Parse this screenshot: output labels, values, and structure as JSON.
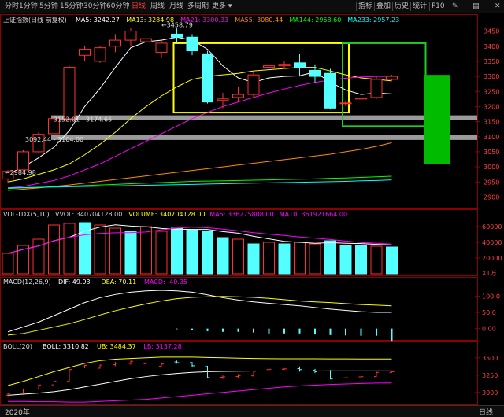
{
  "toolbar": {
    "tabs": [
      {
        "label": "分时",
        "key": "m1"
      },
      {
        "label": "1分钟",
        "key": "min1"
      },
      {
        "label": "5分钟",
        "key": "min5"
      },
      {
        "label": "15分钟",
        "key": "min15"
      },
      {
        "label": "30分钟",
        "key": "min30"
      },
      {
        "label": "60分钟",
        "key": "min60"
      },
      {
        "label": "日线",
        "key": "day"
      },
      {
        "label": "周线",
        "key": "week"
      },
      {
        "label": "月线",
        "key": "month"
      },
      {
        "label": "多周期",
        "key": "multi"
      },
      {
        "label": "更多",
        "key": "more"
      }
    ],
    "right_tabs": [
      "指标",
      "叠加",
      "历史",
      "统计",
      "F10"
    ],
    "right_icon_labels": [
      "画线",
      "选股"
    ]
  },
  "main_chart": {
    "title": "上证指数(日线 前复权)",
    "legend": [
      {
        "text": "MA5: 3242.27",
        "color": "#ffffff"
      },
      {
        "text": "MA13: 3284.98",
        "color": "#ffff00"
      },
      {
        "text": "MA21: 3300.33",
        "color": "#ff00ff"
      },
      {
        "text": "MA55: 3080.44",
        "color": "#ff8c00"
      },
      {
        "text": "MA144: 2968.60",
        "color": "#00ff00"
      },
      {
        "text": "MA233: 2957.23",
        "color": "#00ffff"
      }
    ],
    "y_ticks": [
      "3450",
      "3400",
      "3350",
      "3300",
      "3250",
      "3200",
      "3150",
      "3100",
      "3050",
      "3000",
      "2950",
      "2900"
    ],
    "annotations": [
      "3458.79",
      "3152.01 - 3174.66",
      "3092.44 - 3104.00",
      "2984.98"
    ]
  },
  "volume_chart": {
    "title": "VOL-TDX(5,10)",
    "legend": [
      {
        "text": "VVOL: 340704128.00",
        "color": "#cccccc"
      },
      {
        "text": "VOLUME: 340704128.00",
        "color": "#ffff00"
      },
      {
        "text": "MA5: 336275808.00",
        "color": "#ff00ff"
      },
      {
        "text": "MA10: 361921664.00",
        "color": "#ff00ff"
      }
    ],
    "y_ticks": [
      "60000",
      "40000",
      "20000",
      "X1万"
    ]
  },
  "macd_chart": {
    "title": "MACD(12,26,9)",
    "legend": [
      {
        "text": "DIF: 49.93",
        "color": "#ffffff"
      },
      {
        "text": "DEA: 70.11",
        "color": "#ffff00"
      },
      {
        "text": "MACD: -40.35",
        "color": "#ff00ff"
      }
    ],
    "y_ticks": [
      "100.0",
      "50.0",
      "0.00"
    ]
  },
  "boll_chart": {
    "title": "BOLL(20)",
    "legend": [
      {
        "text": "BOLL: 3310.82",
        "color": "#ffffff"
      },
      {
        "text": "UB: 3484.37",
        "color": "#ffff00"
      },
      {
        "text": "LB: 3137.28",
        "color": "#ff00ff"
      }
    ],
    "y_ticks": [
      "3500",
      "3250",
      "3000"
    ]
  },
  "bottom": {
    "year": "2020年",
    "period": "日线"
  },
  "chart_data": [
    {
      "type": "candlestick",
      "title": "上证指数(日线 前复权)",
      "ylim": [
        2875,
        3475
      ],
      "candles": [
        {
          "o": 2960,
          "h": 2990,
          "l": 2945,
          "c": 2985
        },
        {
          "o": 2990,
          "h": 3055,
          "l": 2985,
          "c": 3050
        },
        {
          "o": 3050,
          "h": 3115,
          "l": 3045,
          "c": 3108
        },
        {
          "o": 3110,
          "h": 3170,
          "l": 3105,
          "c": 3160
        },
        {
          "o": 3160,
          "h": 3335,
          "l": 3158,
          "c": 3330
        },
        {
          "o": 3370,
          "h": 3400,
          "l": 3350,
          "c": 3390
        },
        {
          "o": 3350,
          "h": 3400,
          "l": 3345,
          "c": 3395
        },
        {
          "o": 3400,
          "h": 3440,
          "l": 3380,
          "c": 3420
        },
        {
          "o": 3420,
          "h": 3460,
          "l": 3400,
          "c": 3450
        },
        {
          "o": 3415,
          "h": 3440,
          "l": 3370,
          "c": 3425
        },
        {
          "o": 3380,
          "h": 3420,
          "l": 3360,
          "c": 3410
        },
        {
          "o": 3440,
          "h": 3459,
          "l": 3415,
          "c": 3430
        },
        {
          "o": 3430,
          "h": 3440,
          "l": 3370,
          "c": 3385
        },
        {
          "o": 3375,
          "h": 3385,
          "l": 3210,
          "c": 3215
        },
        {
          "o": 3220,
          "h": 3245,
          "l": 3195,
          "c": 3225
        },
        {
          "o": 3230,
          "h": 3265,
          "l": 3215,
          "c": 3240
        },
        {
          "o": 3240,
          "h": 3315,
          "l": 3230,
          "c": 3305
        },
        {
          "o": 3330,
          "h": 3345,
          "l": 3320,
          "c": 3335
        },
        {
          "o": 3335,
          "h": 3350,
          "l": 3325,
          "c": 3340
        },
        {
          "o": 3345,
          "h": 3375,
          "l": 3300,
          "c": 3330
        },
        {
          "o": 3320,
          "h": 3340,
          "l": 3280,
          "c": 3300
        },
        {
          "o": 3310,
          "h": 3325,
          "l": 3190,
          "c": 3195
        },
        {
          "o": 3210,
          "h": 3220,
          "l": 3200,
          "c": 3212
        },
        {
          "o": 3225,
          "h": 3235,
          "l": 3215,
          "c": 3228
        },
        {
          "o": 3230,
          "h": 3300,
          "l": 3225,
          "c": 3290
        },
        {
          "o": 3290,
          "h": 3305,
          "l": 3285,
          "c": 3300
        }
      ],
      "projection_candle": {
        "o": 3305,
        "c": 3010
      },
      "ma_lines": [
        {
          "name": "MA5",
          "color": "#ffffff",
          "values": [
            2975,
            3000,
            3030,
            3065,
            3120,
            3200,
            3260,
            3330,
            3395,
            3415,
            3420,
            3430,
            3420,
            3390,
            3335,
            3295,
            3280,
            3295,
            3300,
            3302,
            3315,
            3280,
            3255,
            3240,
            3245,
            3242
          ]
        },
        {
          "name": "MA13",
          "color": "#ffff00",
          "values": [
            2950,
            2960,
            2975,
            2990,
            3010,
            3040,
            3075,
            3115,
            3160,
            3200,
            3235,
            3265,
            3290,
            3300,
            3305,
            3310,
            3318,
            3322,
            3326,
            3330,
            3330,
            3318,
            3305,
            3295,
            3290,
            3285
          ]
        },
        {
          "name": "MA21",
          "color": "#ff00ff",
          "values": [
            2930,
            2935,
            2945,
            2955,
            2970,
            2990,
            3010,
            3035,
            3060,
            3085,
            3110,
            3135,
            3160,
            3180,
            3200,
            3215,
            3230,
            3245,
            3258,
            3270,
            3280,
            3288,
            3294,
            3298,
            3300,
            3300
          ]
        },
        {
          "name": "MA55",
          "color": "#ff8c00",
          "values": [
            2922,
            2926,
            2930,
            2935,
            2940,
            2946,
            2952,
            2958,
            2964,
            2970,
            2976,
            2982,
            2988,
            2994,
            3000,
            3006,
            3012,
            3018,
            3024,
            3030,
            3036,
            3042,
            3050,
            3058,
            3068,
            3080
          ]
        },
        {
          "name": "MA144",
          "color": "#00ff00",
          "values": [
            2928,
            2930,
            2932,
            2934,
            2936,
            2938,
            2940,
            2942,
            2944,
            2946,
            2948,
            2950,
            2952,
            2953,
            2954,
            2955,
            2956,
            2957,
            2958,
            2959,
            2960,
            2962,
            2963,
            2965,
            2967,
            2969
          ]
        },
        {
          "name": "MA233",
          "color": "#00ffff",
          "values": [
            2930,
            2931,
            2932,
            2933,
            2934,
            2935,
            2936,
            2937,
            2938,
            2939,
            2940,
            2941,
            2942,
            2943,
            2944,
            2945,
            2946,
            2947,
            2948,
            2949,
            2950,
            2951,
            2952,
            2954,
            2955,
            2957
          ]
        }
      ],
      "horizontal_bands": [
        3163,
        3097
      ],
      "boxes": [
        {
          "from": 11,
          "to": 22,
          "ymin": 3180,
          "ymax": 3410,
          "color": "#ffff00"
        },
        {
          "from": 22,
          "to": 27,
          "ymin": 3135,
          "ymax": 3410,
          "color": "#22cc22"
        }
      ]
    },
    {
      "type": "bar",
      "title": "VOL-TDX(5,10)",
      "ylim": [
        0,
        70000
      ],
      "values": [
        26000,
        36000,
        44000,
        62000,
        64000,
        65000,
        62000,
        58000,
        54000,
        60000,
        54000,
        58000,
        56000,
        54000,
        46000,
        44000,
        38000,
        40000,
        38000,
        40000,
        38000,
        42000,
        36000,
        36000,
        35000,
        34000
      ],
      "colors": [
        "red",
        "red",
        "red",
        "red",
        "red",
        "cyan",
        "red",
        "red",
        "cyan",
        "red",
        "red",
        "cyan",
        "cyan",
        "cyan",
        "cyan",
        "red",
        "cyan",
        "red",
        "cyan",
        "red",
        "red",
        "cyan",
        "cyan",
        "cyan",
        "red",
        "cyan"
      ]
    },
    {
      "type": "line",
      "title": "MACD(12,26,9)",
      "ylim": [
        -30,
        130
      ],
      "series": [
        {
          "name": "DIF",
          "color": "#ffffff",
          "values": [
            -10,
            5,
            20,
            40,
            60,
            80,
            95,
            105,
            112,
            116,
            118,
            116,
            112,
            104,
            95,
            88,
            82,
            78,
            74,
            70,
            65,
            60,
            56,
            52,
            50,
            50
          ]
        },
        {
          "name": "DEA",
          "color": "#ffff00",
          "values": [
            -20,
            -15,
            -5,
            5,
            15,
            28,
            42,
            55,
            66,
            76,
            85,
            92,
            96,
            98,
            99,
            98,
            96,
            93,
            89,
            85,
            82,
            80,
            77,
            74,
            72,
            70
          ]
        }
      ],
      "bars": [
        0,
        0,
        0,
        0,
        0,
        0,
        0,
        0,
        0,
        0,
        0,
        -2,
        -4,
        -8,
        -10,
        -10,
        -12,
        -15,
        -15,
        -15,
        -17,
        -20,
        -21,
        -22,
        -22,
        -40
      ]
    },
    {
      "type": "line",
      "title": "BOLL(20)",
      "ylim": [
        2850,
        3600
      ],
      "series": [
        {
          "name": "UB",
          "color": "#ffff00",
          "values": [
            3100,
            3160,
            3230,
            3300,
            3360,
            3420,
            3460,
            3480,
            3490,
            3500,
            3510,
            3510,
            3510,
            3505,
            3500,
            3495,
            3490,
            3488,
            3486,
            3486,
            3486,
            3485,
            3485,
            3484,
            3484,
            3484
          ]
        },
        {
          "name": "BOLL",
          "color": "#ffffff",
          "values": [
            2960,
            2975,
            2990,
            3010,
            3040,
            3080,
            3120,
            3160,
            3200,
            3230,
            3255,
            3275,
            3290,
            3300,
            3305,
            3308,
            3310,
            3310,
            3310,
            3310,
            3310,
            3311,
            3311,
            3311,
            3311,
            3311
          ]
        },
        {
          "name": "LB",
          "color": "#ff00ff",
          "values": [
            2870,
            2870,
            2865,
            2865,
            2860,
            2860,
            2870,
            2880,
            2890,
            2900,
            2920,
            2940,
            2960,
            2980,
            3000,
            3020,
            3040,
            3060,
            3080,
            3095,
            3105,
            3115,
            3123,
            3130,
            3135,
            3137
          ]
        }
      ]
    }
  ]
}
